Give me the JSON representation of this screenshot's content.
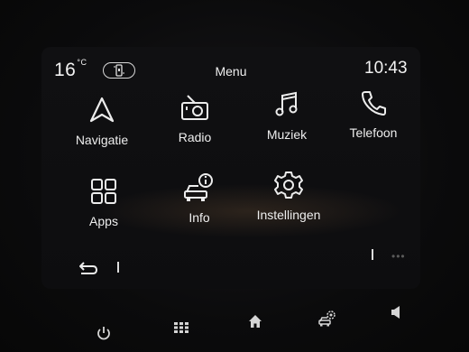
{
  "status_bar": {
    "temperature": "16",
    "temperature_unit": "°C",
    "title": "Menu",
    "time": "10:43"
  },
  "menu_items": [
    {
      "label": "Navigatie",
      "icon": "navigation-arrow-icon"
    },
    {
      "label": "Radio",
      "icon": "radio-icon"
    },
    {
      "label": "Muziek",
      "icon": "music-note-icon"
    },
    {
      "label": "Telefoon",
      "icon": "phone-icon"
    },
    {
      "label": "Apps",
      "icon": "apps-grid-icon"
    },
    {
      "label": "Info",
      "icon": "car-info-icon"
    },
    {
      "label": "Instellingen",
      "icon": "gear-icon"
    }
  ],
  "bottom_bar": {
    "icons": [
      "power-icon",
      "grid-icon",
      "home-icon",
      "car-settings-icon",
      "volume-icon"
    ]
  },
  "colors": {
    "background": "#0b0b0c",
    "foreground": "#e9e9e9"
  }
}
